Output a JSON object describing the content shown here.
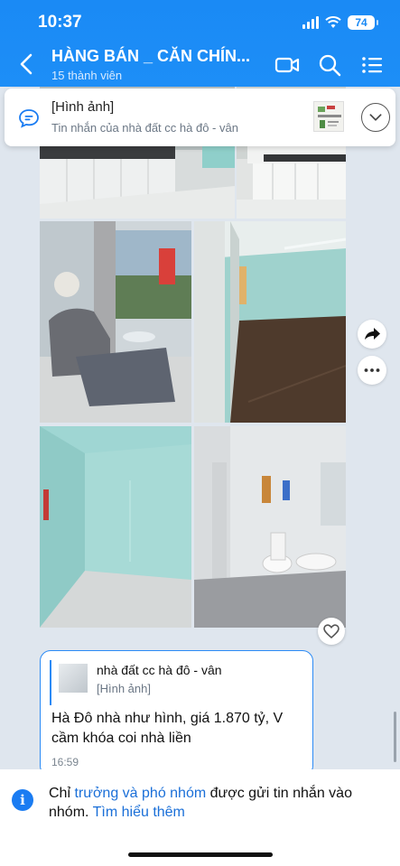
{
  "status_bar": {
    "time": "10:37",
    "battery": "74"
  },
  "header": {
    "title": "HÀNG BÁN _ CĂN CHÍN...",
    "subtitle": "15 thành viên"
  },
  "pinned": {
    "title": "[Hình ảnh]",
    "subtitle": "Tin nhắn của nhà đất cc hà đô - vân"
  },
  "message": {
    "quote_sender": "nhà đất cc hà đô - vân",
    "quote_type": "[Hình ảnh]",
    "text": "Hà Đô nhà như hình, giá 1.870 tỷ, V cầm khóa coi nhà liền",
    "time": "16:59"
  },
  "notice": {
    "prefix": "Chỉ ",
    "roles": "trưởng và phó nhóm",
    "middle": " được gửi tin nhắn vào nhóm. ",
    "link": "Tìm hiểu thêm"
  },
  "icons": [
    "back-icon",
    "video-call-icon",
    "search-icon",
    "list-menu-icon",
    "chat-bubble-icon",
    "chevron-down-icon",
    "share-icon",
    "more-icon",
    "heart-icon",
    "info-icon"
  ]
}
